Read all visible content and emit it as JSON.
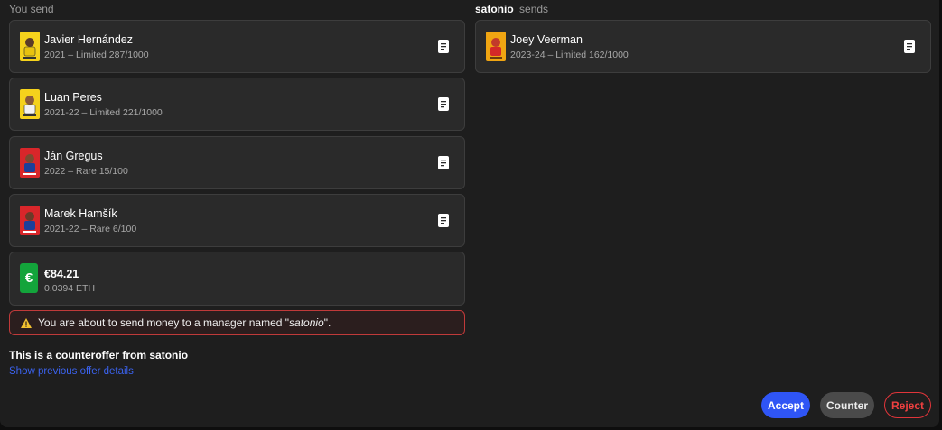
{
  "header": {
    "you_send": "You send",
    "counterparty_name": "satonio",
    "counterparty_sends": "sends"
  },
  "you_send_cards": [
    {
      "name": "Javier Hernández",
      "detail": "2021 – Limited 287/1000",
      "card_color": "#f5d21c",
      "icon": "player-card-icon"
    },
    {
      "name": "Luan Peres",
      "detail": "2021-22 – Limited 221/1000",
      "card_color": "#f5d21c",
      "icon": "player-card-icon"
    },
    {
      "name": "Ján Gregus",
      "detail": "2022 – Rare 15/100",
      "card_color": "#d8262a",
      "icon": "player-card-icon"
    },
    {
      "name": "Marek Hamšík",
      "detail": "2021-22 – Rare 6/100",
      "card_color": "#d8262a",
      "icon": "player-card-icon"
    }
  ],
  "money": {
    "symbol": "€",
    "amount": "€84.21",
    "eth": "0.0394 ETH",
    "badge_color": "#13a43b"
  },
  "they_send_cards": [
    {
      "name": "Joey Veerman",
      "detail": "2023-24 – Limited 162/1000",
      "card_color": "#f0a512",
      "icon": "player-card-icon"
    }
  ],
  "warning": {
    "icon": "⚠",
    "text_before": "You are about to send money to a manager named \"",
    "manager": "satonio",
    "text_after": "\"."
  },
  "counteroffer": {
    "title": "This is a counteroffer from satonio",
    "link": "Show previous offer details"
  },
  "actions": {
    "accept": "Accept",
    "counter": "Counter",
    "reject": "Reject"
  },
  "colors": {
    "accent_blue": "#2f55f5",
    "danger_red": "#e0353a",
    "link_blue": "#3b63f0"
  }
}
